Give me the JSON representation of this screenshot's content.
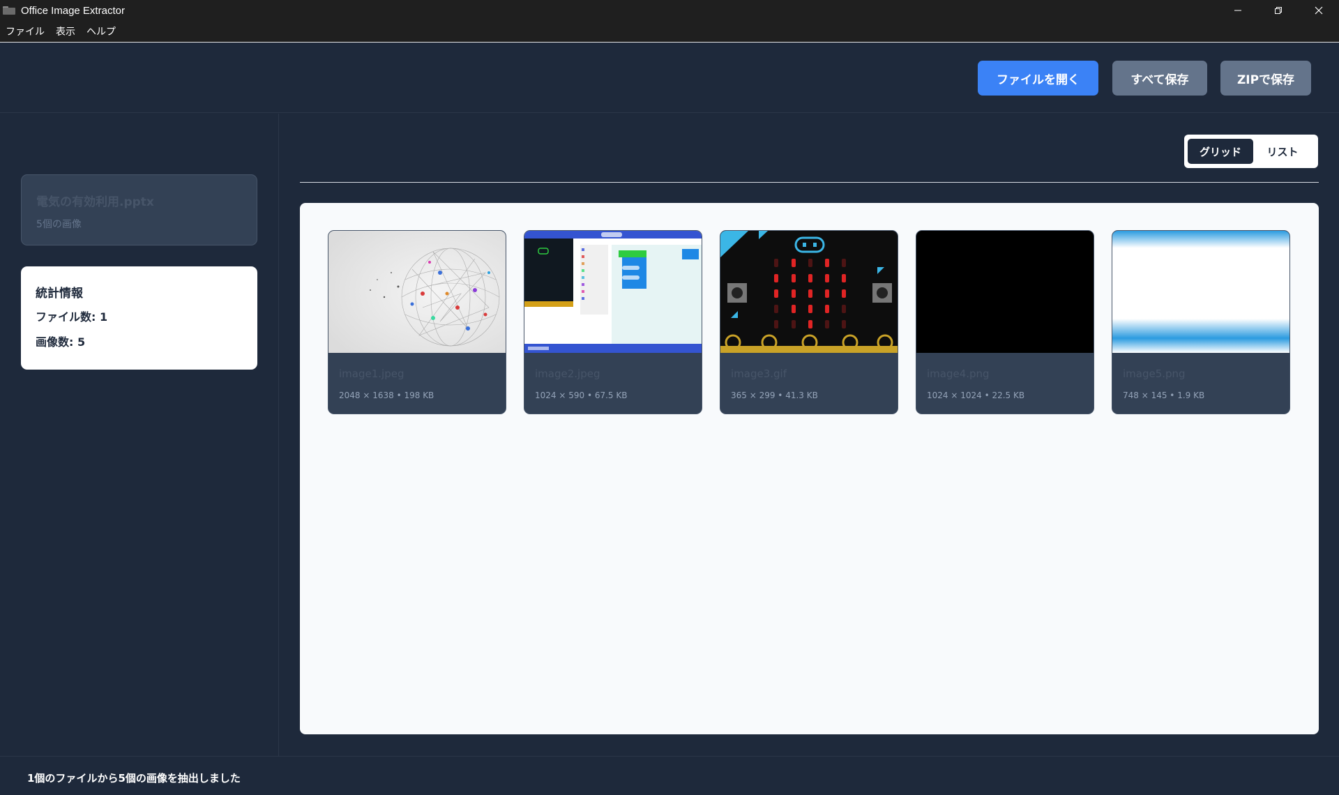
{
  "window": {
    "title": "Office Image Extractor",
    "icon": "folder-icon",
    "controls": [
      "minimize-icon",
      "restore-icon",
      "close-icon"
    ]
  },
  "menu": {
    "items": [
      {
        "label": "ファイル"
      },
      {
        "label": "表示"
      },
      {
        "label": "ヘルプ"
      }
    ]
  },
  "toolbar": {
    "open_label": "ファイルを開く",
    "save_all_label": "すべて保存",
    "zip_label": "ZIPで保存"
  },
  "sidebar": {
    "file": {
      "name": "電気の有効利用.pptx",
      "count": "5個の画像"
    },
    "stats": {
      "title": "統計情報",
      "file_count": "ファイル数: 1",
      "image_count": "画像数: 5"
    }
  },
  "view": {
    "grid_label": "グリッド",
    "list_label": "リスト",
    "active": "grid"
  },
  "images": [
    {
      "name": "image1.jpeg",
      "meta": "2048 × 1638 • 198 KB"
    },
    {
      "name": "image2.jpeg",
      "meta": "1024 × 590 • 67.5 KB"
    },
    {
      "name": "image3.gif",
      "meta": "365 × 299 • 41.3 KB"
    },
    {
      "name": "image4.png",
      "meta": "1024 × 1024 • 22.5 KB"
    },
    {
      "name": "image5.png",
      "meta": "748 × 145 • 1.9 KB"
    }
  ],
  "status": {
    "text": "1個のファイルから5個の画像を抽出しました"
  },
  "colors": {
    "background": "#1e293b",
    "accent": "#3b82f6",
    "secondary_button": "#64748b",
    "card": "#334155",
    "gallery": "#f8fafc"
  }
}
